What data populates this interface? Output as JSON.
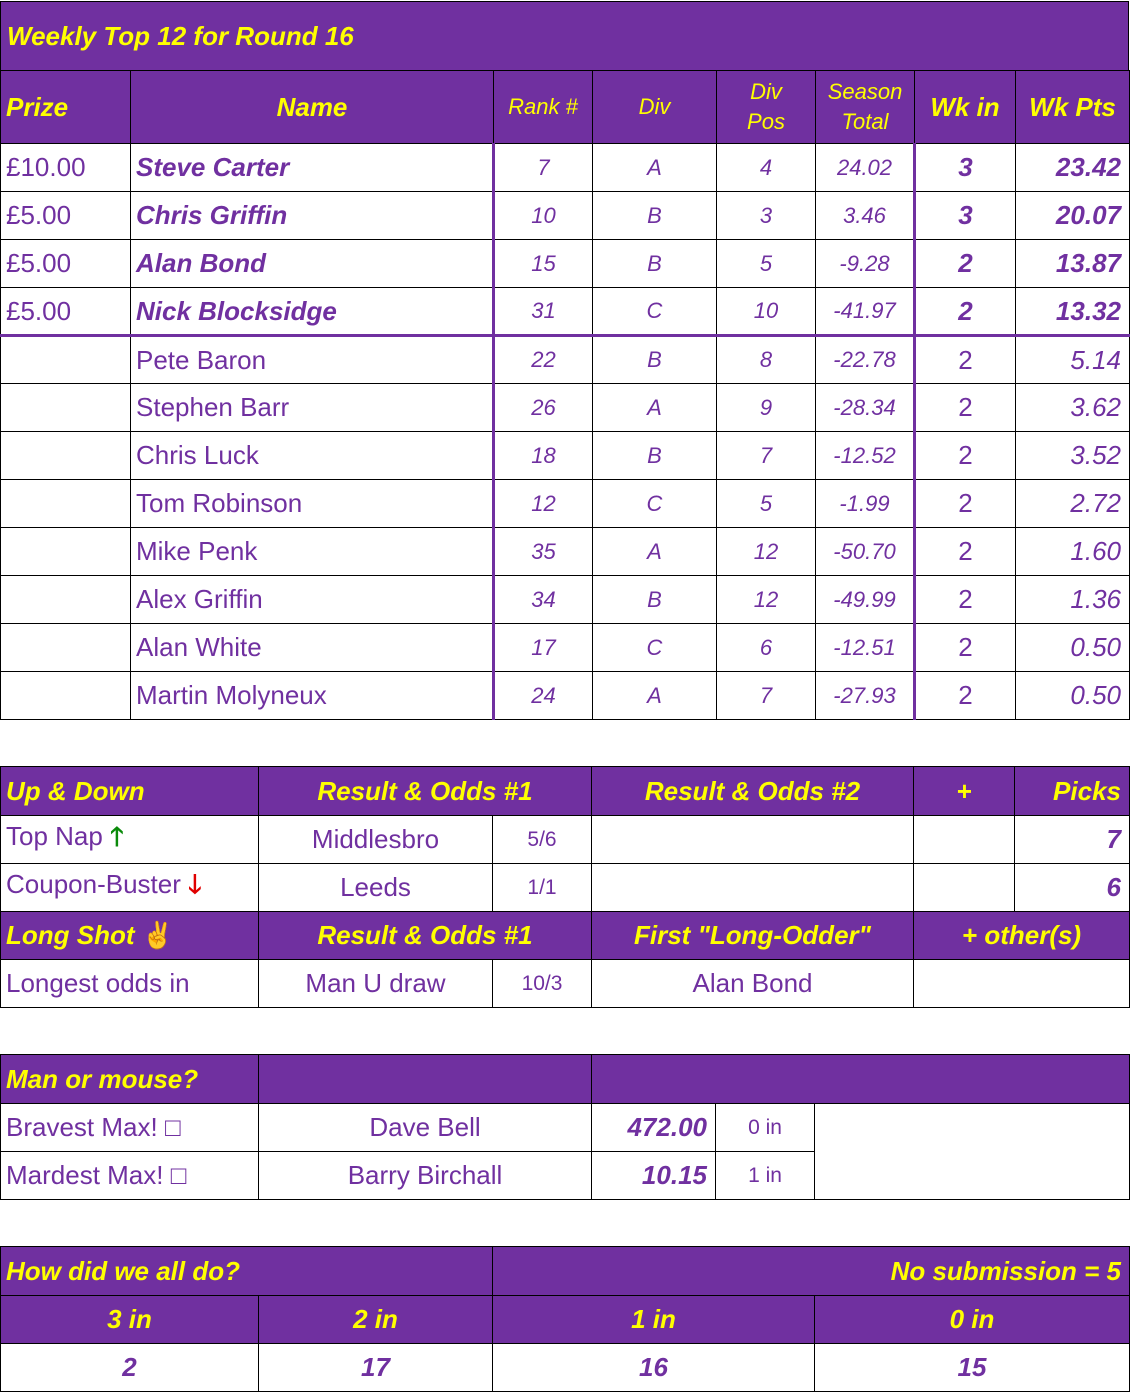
{
  "title": "Weekly Top 12 for Round 16",
  "top12": {
    "headers": {
      "prize": "Prize",
      "name": "Name",
      "rank": "Rank #",
      "div": "Div",
      "div_pos_1": "Div",
      "div_pos_2": "Pos",
      "season_1": "Season",
      "season_2": "Total",
      "wk_in": "Wk in",
      "wk_pts": "Wk Pts"
    },
    "rows": [
      {
        "prize": "£10.00",
        "name": "Steve Carter",
        "rank": "7",
        "div": "A",
        "pos": "4",
        "season": "24.02",
        "wk_in": "3",
        "wk_pts": "23.42"
      },
      {
        "prize": "£5.00",
        "name": "Chris Griffin",
        "rank": "10",
        "div": "B",
        "pos": "3",
        "season": "3.46",
        "wk_in": "3",
        "wk_pts": "20.07"
      },
      {
        "prize": "£5.00",
        "name": "Alan Bond",
        "rank": "15",
        "div": "B",
        "pos": "5",
        "season": "-9.28",
        "wk_in": "2",
        "wk_pts": "13.87"
      },
      {
        "prize": "£5.00",
        "name": "Nick Blocksidge",
        "rank": "31",
        "div": "C",
        "pos": "10",
        "season": "-41.97",
        "wk_in": "2",
        "wk_pts": "13.32"
      },
      {
        "prize": "",
        "name": "Pete Baron",
        "rank": "22",
        "div": "B",
        "pos": "8",
        "season": "-22.78",
        "wk_in": "2",
        "wk_pts": "5.14"
      },
      {
        "prize": "",
        "name": "Stephen Barr",
        "rank": "26",
        "div": "A",
        "pos": "9",
        "season": "-28.34",
        "wk_in": "2",
        "wk_pts": "3.62"
      },
      {
        "prize": "",
        "name": "Chris Luck",
        "rank": "18",
        "div": "B",
        "pos": "7",
        "season": "-12.52",
        "wk_in": "2",
        "wk_pts": "3.52"
      },
      {
        "prize": "",
        "name": "Tom Robinson",
        "rank": "12",
        "div": "C",
        "pos": "5",
        "season": "-1.99",
        "wk_in": "2",
        "wk_pts": "2.72"
      },
      {
        "prize": "",
        "name": "Mike Penk",
        "rank": "35",
        "div": "A",
        "pos": "12",
        "season": "-50.70",
        "wk_in": "2",
        "wk_pts": "1.60"
      },
      {
        "prize": "",
        "name": "Alex Griffin",
        "rank": "34",
        "div": "B",
        "pos": "12",
        "season": "-49.99",
        "wk_in": "2",
        "wk_pts": "1.36"
      },
      {
        "prize": "",
        "name": "Alan White",
        "rank": "17",
        "div": "C",
        "pos": "6",
        "season": "-12.51",
        "wk_in": "2",
        "wk_pts": "0.50"
      },
      {
        "prize": "",
        "name": "Martin Molyneux",
        "rank": "24",
        "div": "A",
        "pos": "7",
        "season": "-27.93",
        "wk_in": "2",
        "wk_pts": "0.50"
      }
    ]
  },
  "updown": {
    "header": {
      "label": "Up & Down",
      "r1": "Result & Odds #1",
      "r2": "Result & Odds #2",
      "plus": "+",
      "picks": "Picks"
    },
    "rows": [
      {
        "label": "Top Nap",
        "arrow": "🡑",
        "result": "Middlesbro",
        "odds": "5/6",
        "picks": "7"
      },
      {
        "label": "Coupon-Buster",
        "arrow": "🡓",
        "result": "Leeds",
        "odds": "1/1",
        "picks": "6"
      }
    ],
    "longshot_header": {
      "label": "Long Shot",
      "icon": "✌",
      "r1": "Result & Odds #1",
      "first": "First \"Long-Odder\"",
      "others": "+ other(s)"
    },
    "longshot_row": {
      "label": "Longest odds in",
      "result": "Man U draw",
      "odds": "10/3",
      "first": "Alan Bond"
    }
  },
  "man_mouse": {
    "title": "Man or mouse?",
    "rows": [
      {
        "label": "Bravest Max!",
        "icon": "□",
        "name": "Dave Bell",
        "value": "472.00",
        "in": "0 in"
      },
      {
        "label": "Mardest Max!",
        "icon": "□",
        "name": "Barry Birchall",
        "value": "10.15",
        "in": "1 in"
      }
    ]
  },
  "summary": {
    "title": "How did we all do?",
    "no_sub": "No submission = 5",
    "headers": [
      "3 in",
      "2 in",
      "1 in",
      "0 in"
    ],
    "values": [
      "2",
      "17",
      "16",
      "15"
    ]
  }
}
